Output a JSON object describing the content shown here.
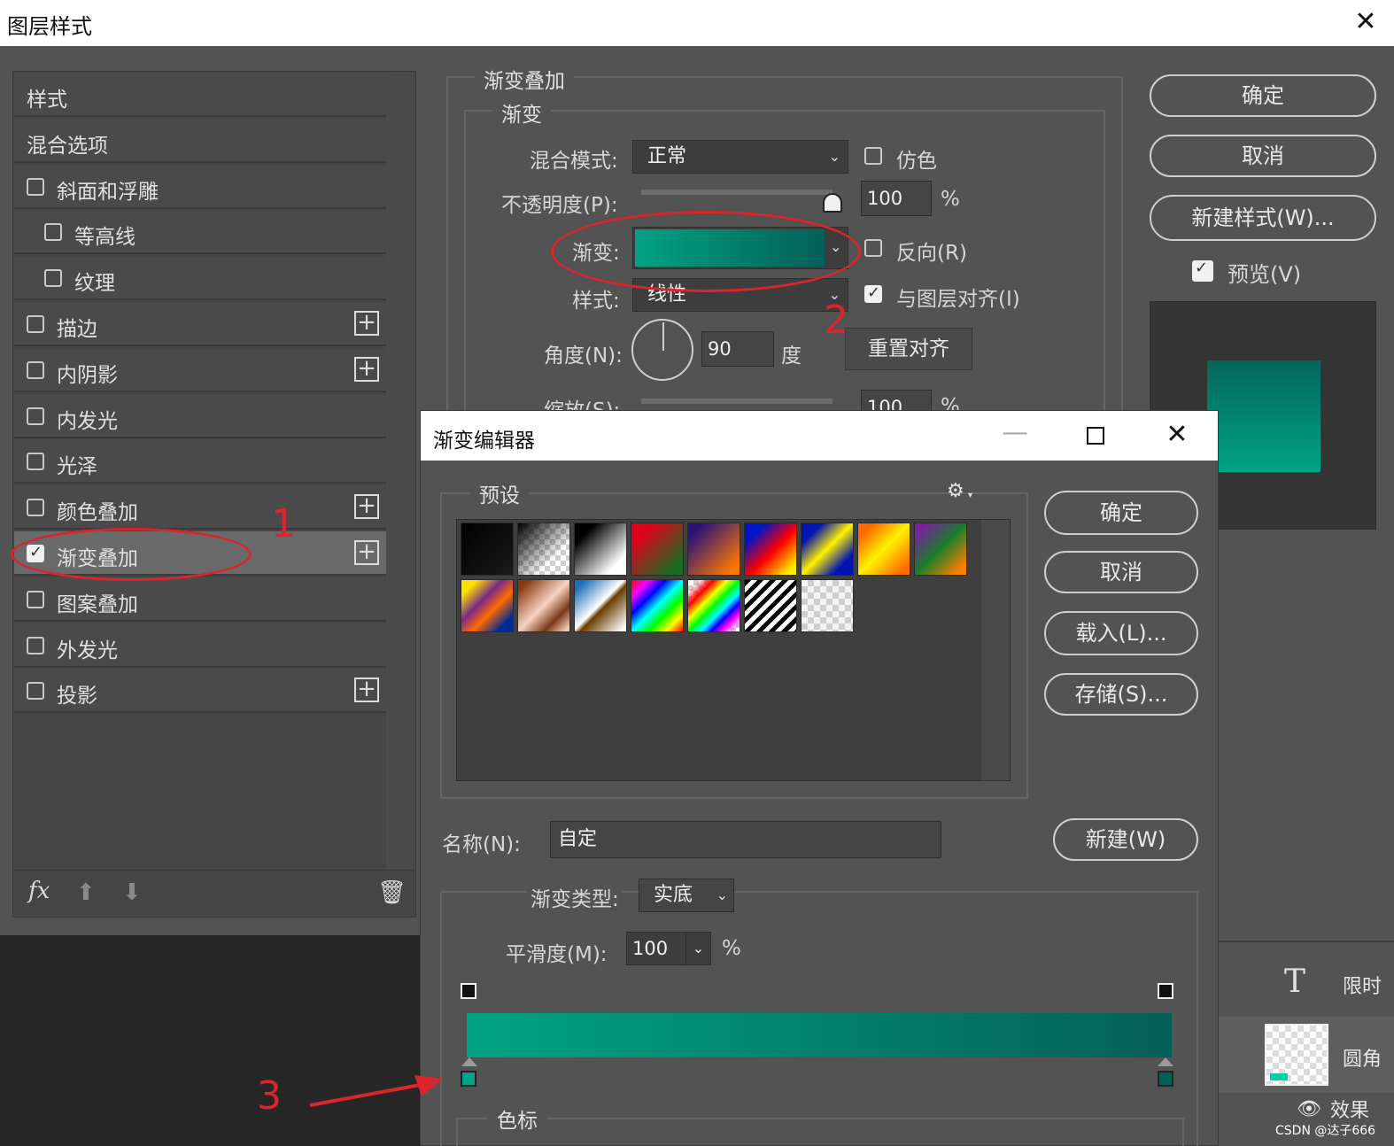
{
  "window": {
    "title": "图层样式",
    "close": "✕"
  },
  "styles_list": {
    "items": [
      {
        "label": "样式",
        "checkbox": false,
        "checked": false,
        "plus": false,
        "indent": false
      },
      {
        "label": "混合选项",
        "checkbox": false,
        "checked": false,
        "plus": false,
        "indent": false
      },
      {
        "label": "斜面和浮雕",
        "checkbox": true,
        "checked": false,
        "plus": false,
        "indent": false
      },
      {
        "label": "等高线",
        "checkbox": true,
        "checked": false,
        "plus": false,
        "indent": true
      },
      {
        "label": "纹理",
        "checkbox": true,
        "checked": false,
        "plus": false,
        "indent": true
      },
      {
        "label": "描边",
        "checkbox": true,
        "checked": false,
        "plus": true,
        "indent": false
      },
      {
        "label": "内阴影",
        "checkbox": true,
        "checked": false,
        "plus": true,
        "indent": false
      },
      {
        "label": "内发光",
        "checkbox": true,
        "checked": false,
        "plus": false,
        "indent": false
      },
      {
        "label": "光泽",
        "checkbox": true,
        "checked": false,
        "plus": false,
        "indent": false
      },
      {
        "label": "颜色叠加",
        "checkbox": true,
        "checked": false,
        "plus": true,
        "indent": false
      },
      {
        "label": "渐变叠加",
        "checkbox": true,
        "checked": true,
        "plus": true,
        "indent": false,
        "selected": true
      },
      {
        "label": "图案叠加",
        "checkbox": true,
        "checked": false,
        "plus": false,
        "indent": false
      },
      {
        "label": "外发光",
        "checkbox": true,
        "checked": false,
        "plus": false,
        "indent": false
      },
      {
        "label": "投影",
        "checkbox": true,
        "checked": false,
        "plus": true,
        "indent": false
      }
    ],
    "footer": {
      "fx": "fx"
    }
  },
  "gradient_overlay": {
    "section_title": "渐变叠加",
    "group_title": "渐变",
    "blend_mode_label": "混合模式:",
    "blend_mode_value": "正常",
    "dither_label": "仿色",
    "opacity_label": "不透明度(P):",
    "opacity_value": "100",
    "percent": "%",
    "gradient_label": "渐变:",
    "reverse_label": "反向(R)",
    "style_label": "样式:",
    "style_value": "线性",
    "align_label": "与图层对齐(I)",
    "angle_label": "角度(N):",
    "angle_value": "90",
    "degree_unit": "度",
    "reset_align": "重置对齐",
    "scale_label": "缩放(S):",
    "scale_value": "100",
    "scale_percent": "%"
  },
  "right_buttons": {
    "ok": "确定",
    "cancel": "取消",
    "new_style": "新建样式(W)...",
    "preview_label": "预览(V)"
  },
  "gradient_editor": {
    "title": "渐变编辑器",
    "presets_label": "预设",
    "ok": "确定",
    "cancel": "取消",
    "load": "载入(L)...",
    "save": "存储(S)...",
    "name_label": "名称(N):",
    "name_value": "自定",
    "new_button": "新建(W)",
    "type_label": "渐变类型:",
    "type_value": "实底",
    "smooth_label": "平滑度(M):",
    "smooth_value": "100",
    "smooth_percent": "%",
    "stops_label": "色标",
    "gradient_colors": [
      "#00a383",
      "#045f58"
    ]
  },
  "annotations": {
    "n1": "1",
    "n2": "2",
    "n3": "3"
  },
  "layers_panel": {
    "text_layer": "限时",
    "shape_layer": "圆角",
    "effects_label": "效果",
    "watermark": "CSDN @达子666"
  },
  "colors": {
    "accent_teal": "#00a383",
    "dark_teal": "#045f58",
    "annotation_red": "#d9252b"
  }
}
